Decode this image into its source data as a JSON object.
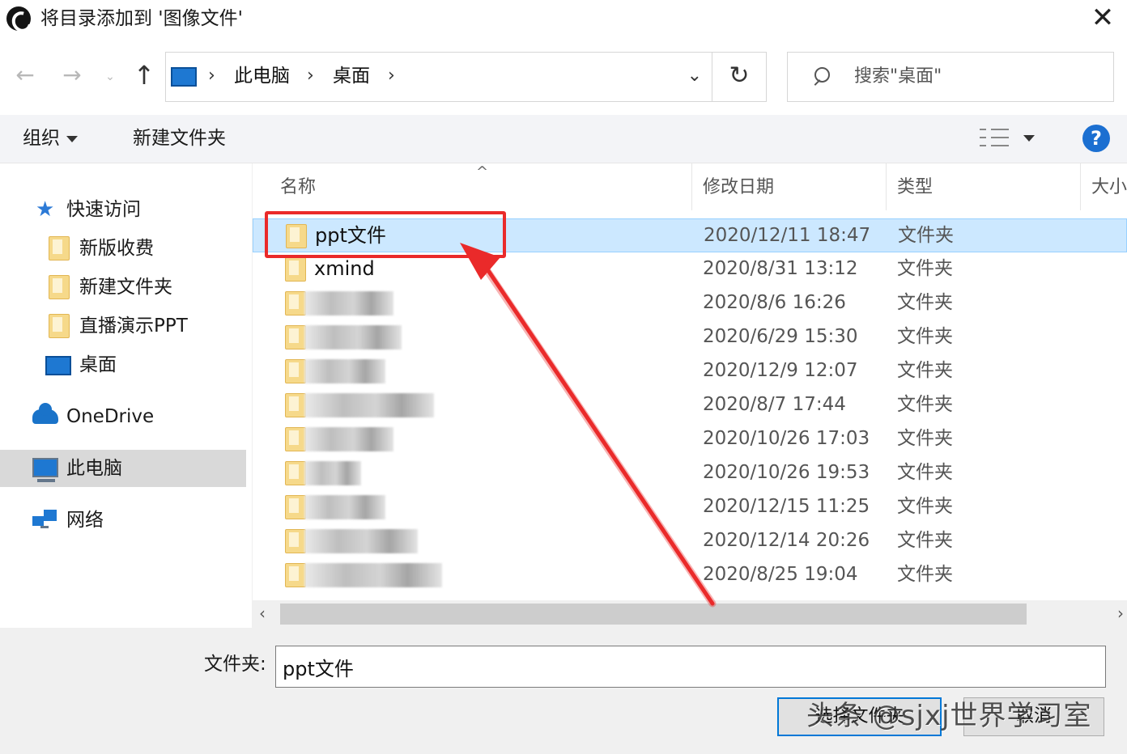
{
  "window": {
    "title": "将目录添加到 '图像文件'",
    "close_glyph": "✕"
  },
  "nav": {
    "back": "←",
    "forward": "→",
    "recent": "⌄",
    "up": "↑",
    "breadcrumb": [
      "此电脑",
      "桌面"
    ],
    "separator": "›",
    "dropdown": "⌄",
    "refresh": "↻",
    "search_placeholder": "搜索\"桌面\""
  },
  "toolbar": {
    "organize": "组织",
    "new_folder": "新建文件夹",
    "help": "?"
  },
  "sidebar": {
    "quick_access": "快速访问",
    "quick_items": [
      "新版收费",
      "新建文件夹",
      "直播演示PPT"
    ],
    "desktop": "桌面",
    "onedrive": "OneDrive",
    "this_pc": "此电脑",
    "network": "网络"
  },
  "columns": {
    "name": "名称",
    "date": "修改日期",
    "type": "类型",
    "size": "大小"
  },
  "files": [
    {
      "name": "ppt文件",
      "date": "2020/12/11 18:47",
      "type": "文件夹"
    },
    {
      "name": "xmind",
      "date": "2020/8/31 13:12",
      "type": "文件夹"
    },
    {
      "name": "",
      "date": "2020/8/6 16:26",
      "type": "文件夹"
    },
    {
      "name": "",
      "date": "2020/6/29 15:30",
      "type": "文件夹"
    },
    {
      "name": "",
      "date": "2020/12/9 12:07",
      "type": "文件夹"
    },
    {
      "name": "",
      "date": "2020/8/7 17:44",
      "type": "文件夹"
    },
    {
      "name": "",
      "date": "2020/10/26 17:03",
      "type": "文件夹"
    },
    {
      "name": "",
      "date": "2020/10/26 19:53",
      "type": "文件夹"
    },
    {
      "name": "",
      "date": "2020/12/15 11:25",
      "type": "文件夹"
    },
    {
      "name": "",
      "date": "2020/12/14 20:26",
      "type": "文件夹"
    },
    {
      "name": "",
      "date": "2020/8/25 19:04",
      "type": "文件夹"
    }
  ],
  "scroll": {
    "left": "‹",
    "right": "›"
  },
  "footer": {
    "folder_label": "文件夹:",
    "folder_value": "ppt文件",
    "select_button": "选择文件夹",
    "cancel_button": "取消"
  },
  "watermark": "头条 @sjxj世界学习室",
  "colors": {
    "accent": "#0078d7",
    "selection": "#cce8ff",
    "annotation": "#ea2a2a",
    "folder": "#f6d98a"
  }
}
